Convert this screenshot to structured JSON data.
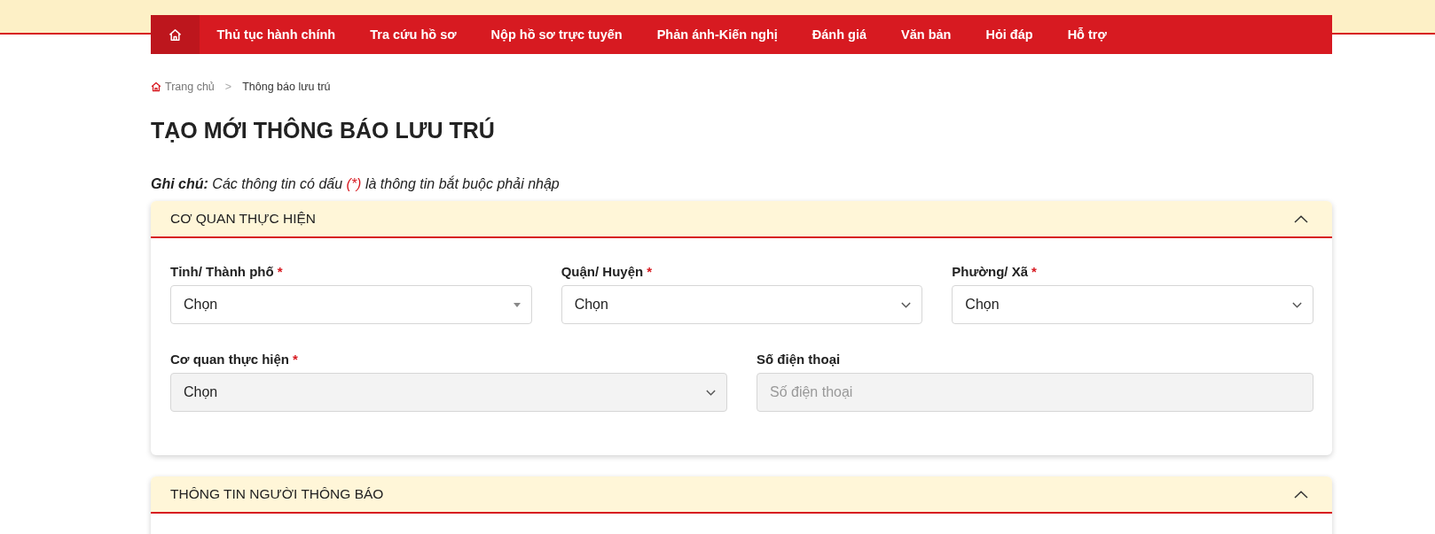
{
  "header": {
    "nav": [
      {
        "kind": "home",
        "selected": true
      },
      {
        "kind": "link",
        "label": "Thủ tục hành chính",
        "selected": false
      },
      {
        "kind": "link",
        "label": "Tra cứu hồ sơ",
        "selected": false
      },
      {
        "kind": "link",
        "label": "Nộp hồ sơ trực tuyến",
        "selected": false
      },
      {
        "kind": "link",
        "label": "Phản ánh-Kiến nghị",
        "selected": false
      },
      {
        "kind": "link",
        "label": "Đánh giá",
        "selected": false
      },
      {
        "kind": "link",
        "label": "Văn bản",
        "selected": false
      },
      {
        "kind": "link",
        "label": "Hỏi đáp",
        "selected": false
      },
      {
        "kind": "link",
        "label": "Hỗ trợ",
        "selected": false
      }
    ]
  },
  "breadcrumb": {
    "separator": ">",
    "items": [
      {
        "kind": "home",
        "label": "Trang chủ"
      },
      {
        "kind": "current",
        "label": "Thông báo lưu trú"
      }
    ]
  },
  "title": "TẠO MỚI THÔNG BÁO LƯU TRÚ",
  "note": {
    "segments": [
      {
        "kind": "label",
        "text": "Ghi chú:"
      },
      {
        "kind": "plain",
        "text": "Các thông tin có dấu"
      },
      {
        "kind": "required",
        "text": "(*)"
      },
      {
        "kind": "plain",
        "text": "là thông tin bắt buộc phải nhập"
      }
    ]
  },
  "sections": [
    {
      "title": "CƠ QUAN THỰC HIỆN",
      "expanded": true,
      "rows": [
        {
          "fields": [
            {
              "kind": "combobox",
              "label": "Tỉnh/ Thành phố",
              "required_mark": "*",
              "value": "Chọn",
              "disabled": false
            },
            {
              "kind": "select",
              "label": "Quận/ Huyện",
              "required_mark": "*",
              "value": "Chọn",
              "disabled": false
            },
            {
              "kind": "select",
              "label": "Phường/ Xã",
              "required_mark": "*",
              "value": "Chọn",
              "disabled": false
            }
          ]
        },
        {
          "fields": [
            {
              "kind": "select",
              "label": "Cơ quan thực hiện",
              "required_mark": "*",
              "value": "Chọn",
              "disabled": true
            },
            {
              "kind": "text",
              "label": "Số điện thoại",
              "placeholder": "Số điện thoại",
              "disabled": true
            }
          ]
        }
      ]
    },
    {
      "title": "THÔNG TIN NGƯỜI THÔNG BÁO",
      "expanded": true
    }
  ]
}
